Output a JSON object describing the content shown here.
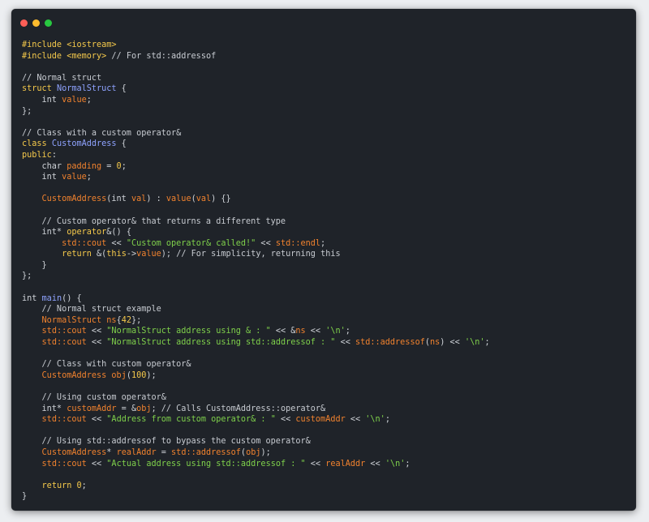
{
  "window": {
    "traffic_lights": {
      "close_color": "#fe5f57",
      "minimize_color": "#febc2e",
      "maximize_color": "#28c840"
    },
    "background": "#1f2329"
  },
  "code": {
    "language": "cpp",
    "lines": [
      [
        {
          "t": "#include <iostream>",
          "c": "kw"
        }
      ],
      [
        {
          "t": "#include <memory>",
          "c": "kw"
        },
        {
          "t": " // For std::addressof",
          "c": "cm"
        }
      ],
      [],
      [
        {
          "t": "// Normal struct",
          "c": "cm"
        }
      ],
      [
        {
          "t": "struct ",
          "c": "kw"
        },
        {
          "t": "NormalStruct",
          "c": "ty"
        },
        {
          "t": " {",
          "c": ""
        }
      ],
      [
        {
          "t": "    int ",
          "c": ""
        },
        {
          "t": "value",
          "c": "fn"
        },
        {
          "t": ";",
          "c": ""
        }
      ],
      [
        {
          "t": "};",
          "c": ""
        }
      ],
      [],
      [
        {
          "t": "// Class with a custom operator&",
          "c": "cm"
        }
      ],
      [
        {
          "t": "class ",
          "c": "kw"
        },
        {
          "t": "CustomAddress",
          "c": "ty"
        },
        {
          "t": " {",
          "c": ""
        }
      ],
      [
        {
          "t": "public",
          "c": "kw"
        },
        {
          "t": ":",
          "c": ""
        }
      ],
      [
        {
          "t": "    char ",
          "c": ""
        },
        {
          "t": "padding",
          "c": "fn"
        },
        {
          "t": " = ",
          "c": ""
        },
        {
          "t": "0",
          "c": "num"
        },
        {
          "t": ";",
          "c": ""
        }
      ],
      [
        {
          "t": "    int ",
          "c": ""
        },
        {
          "t": "value",
          "c": "fn"
        },
        {
          "t": ";",
          "c": ""
        }
      ],
      [],
      [
        {
          "t": "    ",
          "c": ""
        },
        {
          "t": "CustomAddress",
          "c": "fn"
        },
        {
          "t": "(int ",
          "c": ""
        },
        {
          "t": "val",
          "c": "fn"
        },
        {
          "t": ") : ",
          "c": ""
        },
        {
          "t": "value",
          "c": "fn"
        },
        {
          "t": "(",
          "c": ""
        },
        {
          "t": "val",
          "c": "fn"
        },
        {
          "t": ") {}",
          "c": ""
        }
      ],
      [],
      [
        {
          "t": "    // Custom operator& that returns a different type",
          "c": "cm"
        }
      ],
      [
        {
          "t": "    int* ",
          "c": ""
        },
        {
          "t": "operator",
          "c": "kw"
        },
        {
          "t": "&() {",
          "c": ""
        }
      ],
      [
        {
          "t": "        ",
          "c": ""
        },
        {
          "t": "std::cout",
          "c": "fn"
        },
        {
          "t": " << ",
          "c": ""
        },
        {
          "t": "\"Custom operator& called!\"",
          "c": "st"
        },
        {
          "t": " << ",
          "c": ""
        },
        {
          "t": "std::endl",
          "c": "fn"
        },
        {
          "t": ";",
          "c": ""
        }
      ],
      [
        {
          "t": "        ",
          "c": ""
        },
        {
          "t": "return",
          "c": "kw"
        },
        {
          "t": " &(",
          "c": ""
        },
        {
          "t": "this",
          "c": "kw"
        },
        {
          "t": "->",
          "c": ""
        },
        {
          "t": "value",
          "c": "fn"
        },
        {
          "t": "); // For simplicity, returning this",
          "c": "cm"
        }
      ],
      [
        {
          "t": "    }",
          "c": ""
        }
      ],
      [
        {
          "t": "};",
          "c": ""
        }
      ],
      [],
      [
        {
          "t": "int ",
          "c": ""
        },
        {
          "t": "main",
          "c": "ty"
        },
        {
          "t": "() {",
          "c": ""
        }
      ],
      [
        {
          "t": "    // Normal struct example",
          "c": "cm"
        }
      ],
      [
        {
          "t": "    ",
          "c": ""
        },
        {
          "t": "NormalStruct",
          "c": "fn"
        },
        {
          "t": " ",
          "c": ""
        },
        {
          "t": "ns",
          "c": "fn"
        },
        {
          "t": "{",
          "c": ""
        },
        {
          "t": "42",
          "c": "num"
        },
        {
          "t": "};",
          "c": ""
        }
      ],
      [
        {
          "t": "    ",
          "c": ""
        },
        {
          "t": "std::cout",
          "c": "fn"
        },
        {
          "t": " << ",
          "c": ""
        },
        {
          "t": "\"NormalStruct address using & : \"",
          "c": "st"
        },
        {
          "t": " << &",
          "c": ""
        },
        {
          "t": "ns",
          "c": "fn"
        },
        {
          "t": " << ",
          "c": ""
        },
        {
          "t": "'\\n'",
          "c": "st"
        },
        {
          "t": ";",
          "c": ""
        }
      ],
      [
        {
          "t": "    ",
          "c": ""
        },
        {
          "t": "std::cout",
          "c": "fn"
        },
        {
          "t": " << ",
          "c": ""
        },
        {
          "t": "\"NormalStruct address using std::addressof : \"",
          "c": "st"
        },
        {
          "t": " << ",
          "c": ""
        },
        {
          "t": "std::addressof",
          "c": "fn"
        },
        {
          "t": "(",
          "c": ""
        },
        {
          "t": "ns",
          "c": "fn"
        },
        {
          "t": ") << ",
          "c": ""
        },
        {
          "t": "'\\n'",
          "c": "st"
        },
        {
          "t": ";",
          "c": ""
        }
      ],
      [],
      [
        {
          "t": "    // Class with custom operator&",
          "c": "cm"
        }
      ],
      [
        {
          "t": "    ",
          "c": ""
        },
        {
          "t": "CustomAddress",
          "c": "fn"
        },
        {
          "t": " ",
          "c": ""
        },
        {
          "t": "obj",
          "c": "fn"
        },
        {
          "t": "(",
          "c": ""
        },
        {
          "t": "100",
          "c": "num"
        },
        {
          "t": ");",
          "c": ""
        }
      ],
      [],
      [
        {
          "t": "    // Using custom operator&",
          "c": "cm"
        }
      ],
      [
        {
          "t": "    int* ",
          "c": ""
        },
        {
          "t": "customAddr",
          "c": "fn"
        },
        {
          "t": " = &",
          "c": ""
        },
        {
          "t": "obj",
          "c": "fn"
        },
        {
          "t": "; // Calls CustomAddress::operator&",
          "c": "cm"
        }
      ],
      [
        {
          "t": "    ",
          "c": ""
        },
        {
          "t": "std::cout",
          "c": "fn"
        },
        {
          "t": " << ",
          "c": ""
        },
        {
          "t": "\"Address from custom operator& : \"",
          "c": "st"
        },
        {
          "t": " << ",
          "c": ""
        },
        {
          "t": "customAddr",
          "c": "fn"
        },
        {
          "t": " << ",
          "c": ""
        },
        {
          "t": "'\\n'",
          "c": "st"
        },
        {
          "t": ";",
          "c": ""
        }
      ],
      [],
      [
        {
          "t": "    // Using std::addressof to bypass the custom operator&",
          "c": "cm"
        }
      ],
      [
        {
          "t": "    ",
          "c": ""
        },
        {
          "t": "CustomAddress",
          "c": "fn"
        },
        {
          "t": "* ",
          "c": ""
        },
        {
          "t": "realAddr",
          "c": "fn"
        },
        {
          "t": " = ",
          "c": ""
        },
        {
          "t": "std::addressof",
          "c": "fn"
        },
        {
          "t": "(",
          "c": ""
        },
        {
          "t": "obj",
          "c": "fn"
        },
        {
          "t": ");",
          "c": ""
        }
      ],
      [
        {
          "t": "    ",
          "c": ""
        },
        {
          "t": "std::cout",
          "c": "fn"
        },
        {
          "t": " << ",
          "c": ""
        },
        {
          "t": "\"Actual address using std::addressof : \"",
          "c": "st"
        },
        {
          "t": " << ",
          "c": ""
        },
        {
          "t": "realAddr",
          "c": "fn"
        },
        {
          "t": " << ",
          "c": ""
        },
        {
          "t": "'\\n'",
          "c": "st"
        },
        {
          "t": ";",
          "c": ""
        }
      ],
      [],
      [
        {
          "t": "    ",
          "c": ""
        },
        {
          "t": "return",
          "c": "kw"
        },
        {
          "t": " ",
          "c": ""
        },
        {
          "t": "0",
          "c": "num"
        },
        {
          "t": ";",
          "c": ""
        }
      ],
      [
        {
          "t": "}",
          "c": ""
        }
      ]
    ]
  }
}
